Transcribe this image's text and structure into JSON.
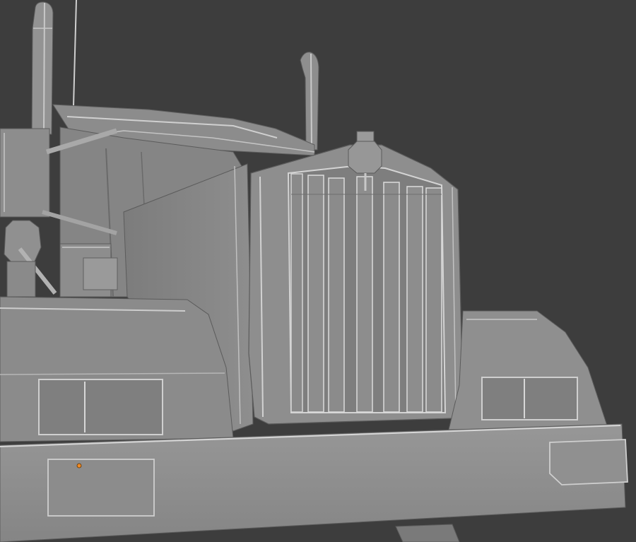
{
  "viewport": {
    "background": "#3d3d3d",
    "model_fill": "#8f8f8f",
    "model_dark": "#6f6f6f",
    "model_light": "#a8a8a8",
    "edge_highlight": "#d8d8d8",
    "edge_dark": "#555555",
    "selected_vertex_color": "#f08a24",
    "grille_bar_count": 7
  }
}
